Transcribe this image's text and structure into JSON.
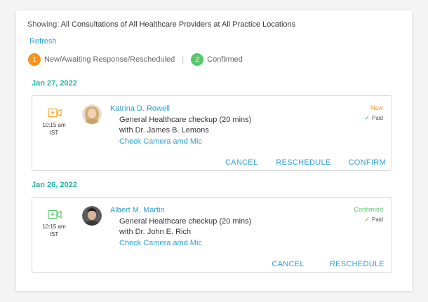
{
  "filter": {
    "prefix": "Showing:",
    "value": "All Consultations of All Healthcare Providers at All Practice Locations"
  },
  "refresh_label": "Refresh",
  "legend": {
    "new": {
      "number": "1",
      "label": "New/Awaiting Response/Rescheduled",
      "color": "#f7941d"
    },
    "separator": "|",
    "confirmed": {
      "number": "2",
      "label": "Confirmed",
      "color": "#57c86a"
    }
  },
  "groups": [
    {
      "date": "Jan 27, 2022",
      "appointment": {
        "time": "10:15 am",
        "timezone": "IST",
        "patient": "Katrina D. Rowell",
        "service": "General Healthcare checkup (20 mins)",
        "doctor": "with Dr. James B. Lemons",
        "camera_link": "Check Camera amd Mic",
        "status": "New",
        "status_color": "#f7941d",
        "payment": "Paid",
        "video_icon_color": "#f0a52a",
        "actions": {
          "cancel": "CANCEL",
          "reschedule": "RESCHEDULE",
          "confirm": "CONFIRM"
        }
      }
    },
    {
      "date": "Jan 26, 2022",
      "appointment": {
        "time": "10:15 am",
        "timezone": "IST",
        "patient": "Albert M. Martin",
        "service": "General Healthcare checkup (20 mins)",
        "doctor": "with Dr. John E. Rich",
        "camera_link": "Check Camera amd Mic",
        "status": "Confirmed",
        "status_color": "#57c86a",
        "payment": "Paid",
        "video_icon_color": "#57c86a",
        "actions": {
          "cancel": "CANCEL",
          "reschedule": "RESCHEDULE"
        }
      }
    }
  ]
}
